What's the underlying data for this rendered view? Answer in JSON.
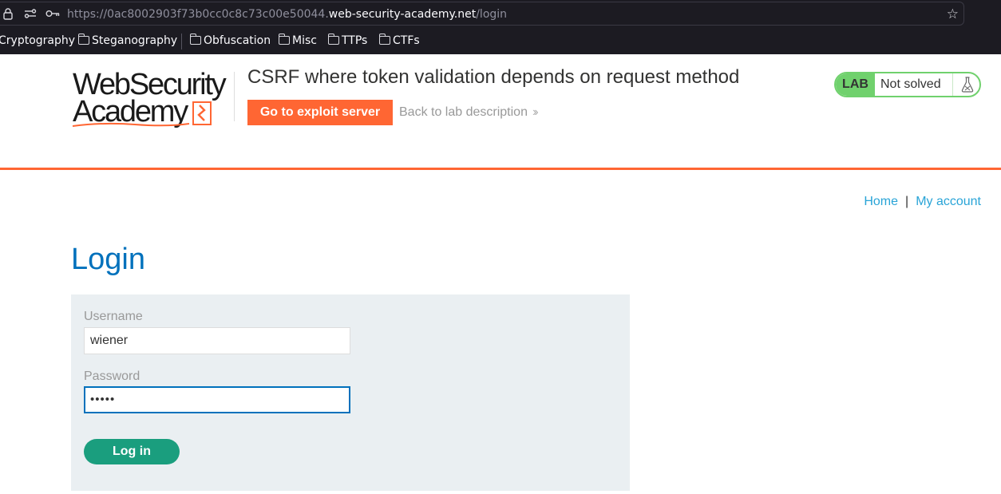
{
  "browser": {
    "url_prefix": "https://0ac8002903f73b0cc0c8c73c00e50044.",
    "url_host": "web-security-academy.net",
    "url_path": "/login",
    "bookmarks": [
      {
        "label": "Cryptography",
        "folder": false
      },
      {
        "label": "Steganography",
        "folder": true
      },
      {
        "label": "Obfuscation",
        "folder": true
      },
      {
        "label": "Misc",
        "folder": true
      },
      {
        "label": "TTPs",
        "folder": true
      },
      {
        "label": "CTFs",
        "folder": true
      }
    ]
  },
  "header": {
    "logo_line1": "WebSecurity",
    "logo_line2": "Academy",
    "lab_title": "CSRF where token validation depends on request method",
    "exploit_button": "Go to exploit server",
    "back_link": "Back to lab description",
    "status_tag": "LAB",
    "status_text": "Not solved"
  },
  "nav": {
    "home": "Home",
    "separator": "|",
    "my_account": "My account"
  },
  "page": {
    "title": "Login",
    "username_label": "Username",
    "username_value": "wiener",
    "password_label": "Password",
    "password_value": "•••••",
    "login_button": "Log in"
  },
  "colors": {
    "accent_orange": "#ff6633",
    "link_blue": "#29a4d7",
    "title_blue": "#0071bc",
    "button_green": "#1a9e7e",
    "status_green": "#70d16d"
  }
}
